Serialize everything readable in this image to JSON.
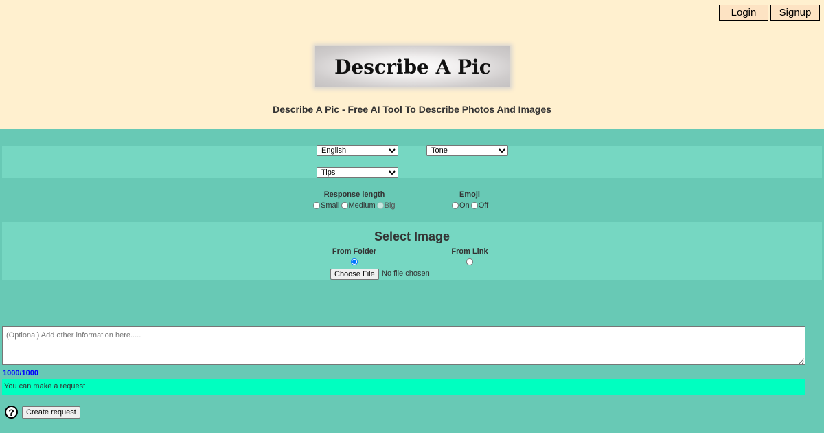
{
  "header": {
    "login_label": "Login",
    "signup_label": "Signup",
    "logo_text": "Describe A Pic",
    "tagline": "Describe A Pic - Free AI Tool To Describe Photos And Images",
    "background_color": "#fff0cf"
  },
  "options": {
    "language": {
      "selected": "English"
    },
    "tone": {
      "selected": "Tone"
    },
    "tips": {
      "selected": "Tips"
    },
    "response_length": {
      "label": "Response length",
      "options": [
        "Small",
        "Medium",
        "Big"
      ],
      "selected": null
    },
    "emoji": {
      "label": "Emoji",
      "options": [
        "On",
        "Off"
      ],
      "selected": null
    }
  },
  "image_source": {
    "title": "Select Image",
    "from_folder_label": "From Folder",
    "from_link_label": "From Link",
    "selected": "From Folder",
    "choose_file_label": "Choose File",
    "file_status": "No file chosen"
  },
  "extra_info": {
    "placeholder": "(Optional) Add other information here.....",
    "char_count": "1000/1000"
  },
  "status": {
    "message": "You can make a request",
    "color": "#00ffc0"
  },
  "actions": {
    "help_icon": "question-circle-icon",
    "help_glyph": "?",
    "create_label": "Create request"
  },
  "colors": {
    "page_background": "#68c9b5",
    "panel_background": "#76d7c2",
    "char_count_color": "#0000ff"
  }
}
